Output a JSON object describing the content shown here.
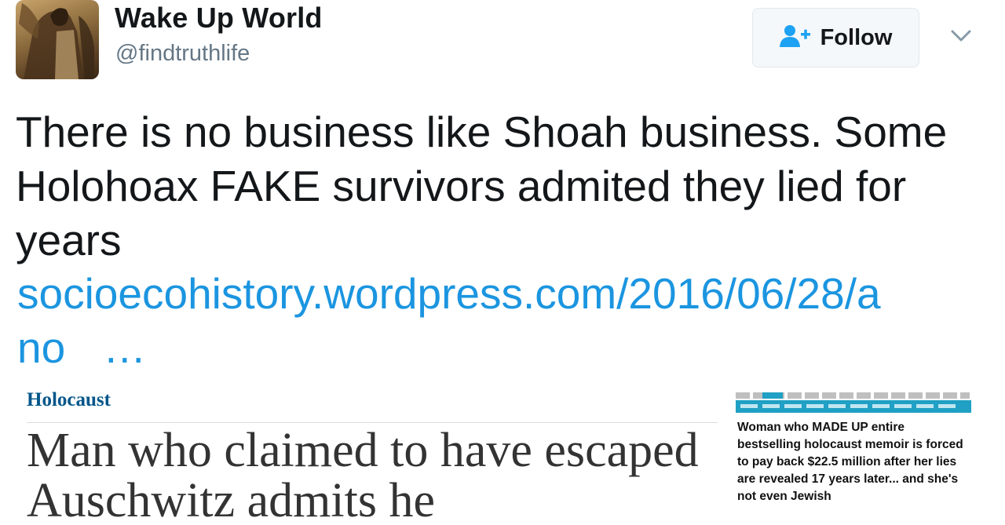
{
  "user": {
    "display_name": "Wake Up World",
    "handle": "@findtruthlife"
  },
  "follow_button": {
    "label": "Follow",
    "icon": "add-user-icon"
  },
  "menu": {
    "icon": "chevron-down-icon"
  },
  "tweet": {
    "text": "There is no business like Shoah business. Some Holohoax FAKE survivors admited they lied for years",
    "link_line1": "socioecohistory.wordpress.com/2016/06/28/a",
    "link_line2": "no",
    "link_ellipsis": "…"
  },
  "media_left": {
    "section": "Holocaust",
    "headline": "Man who claimed to have escaped Auschwitz admits he"
  },
  "media_right": {
    "headline": "Woman who MADE UP entire bestselling holocaust memoir is forced to pay back $22.5 million after her lies are revealed 17 years later... and she's not even Jewish"
  },
  "colors": {
    "link": "#1b95e0",
    "text": "#14171a",
    "muted": "#657786",
    "follow_icon": "#1da1f2",
    "guardian_section": "#005689",
    "dailymail_bar": "#1fa0c4"
  }
}
